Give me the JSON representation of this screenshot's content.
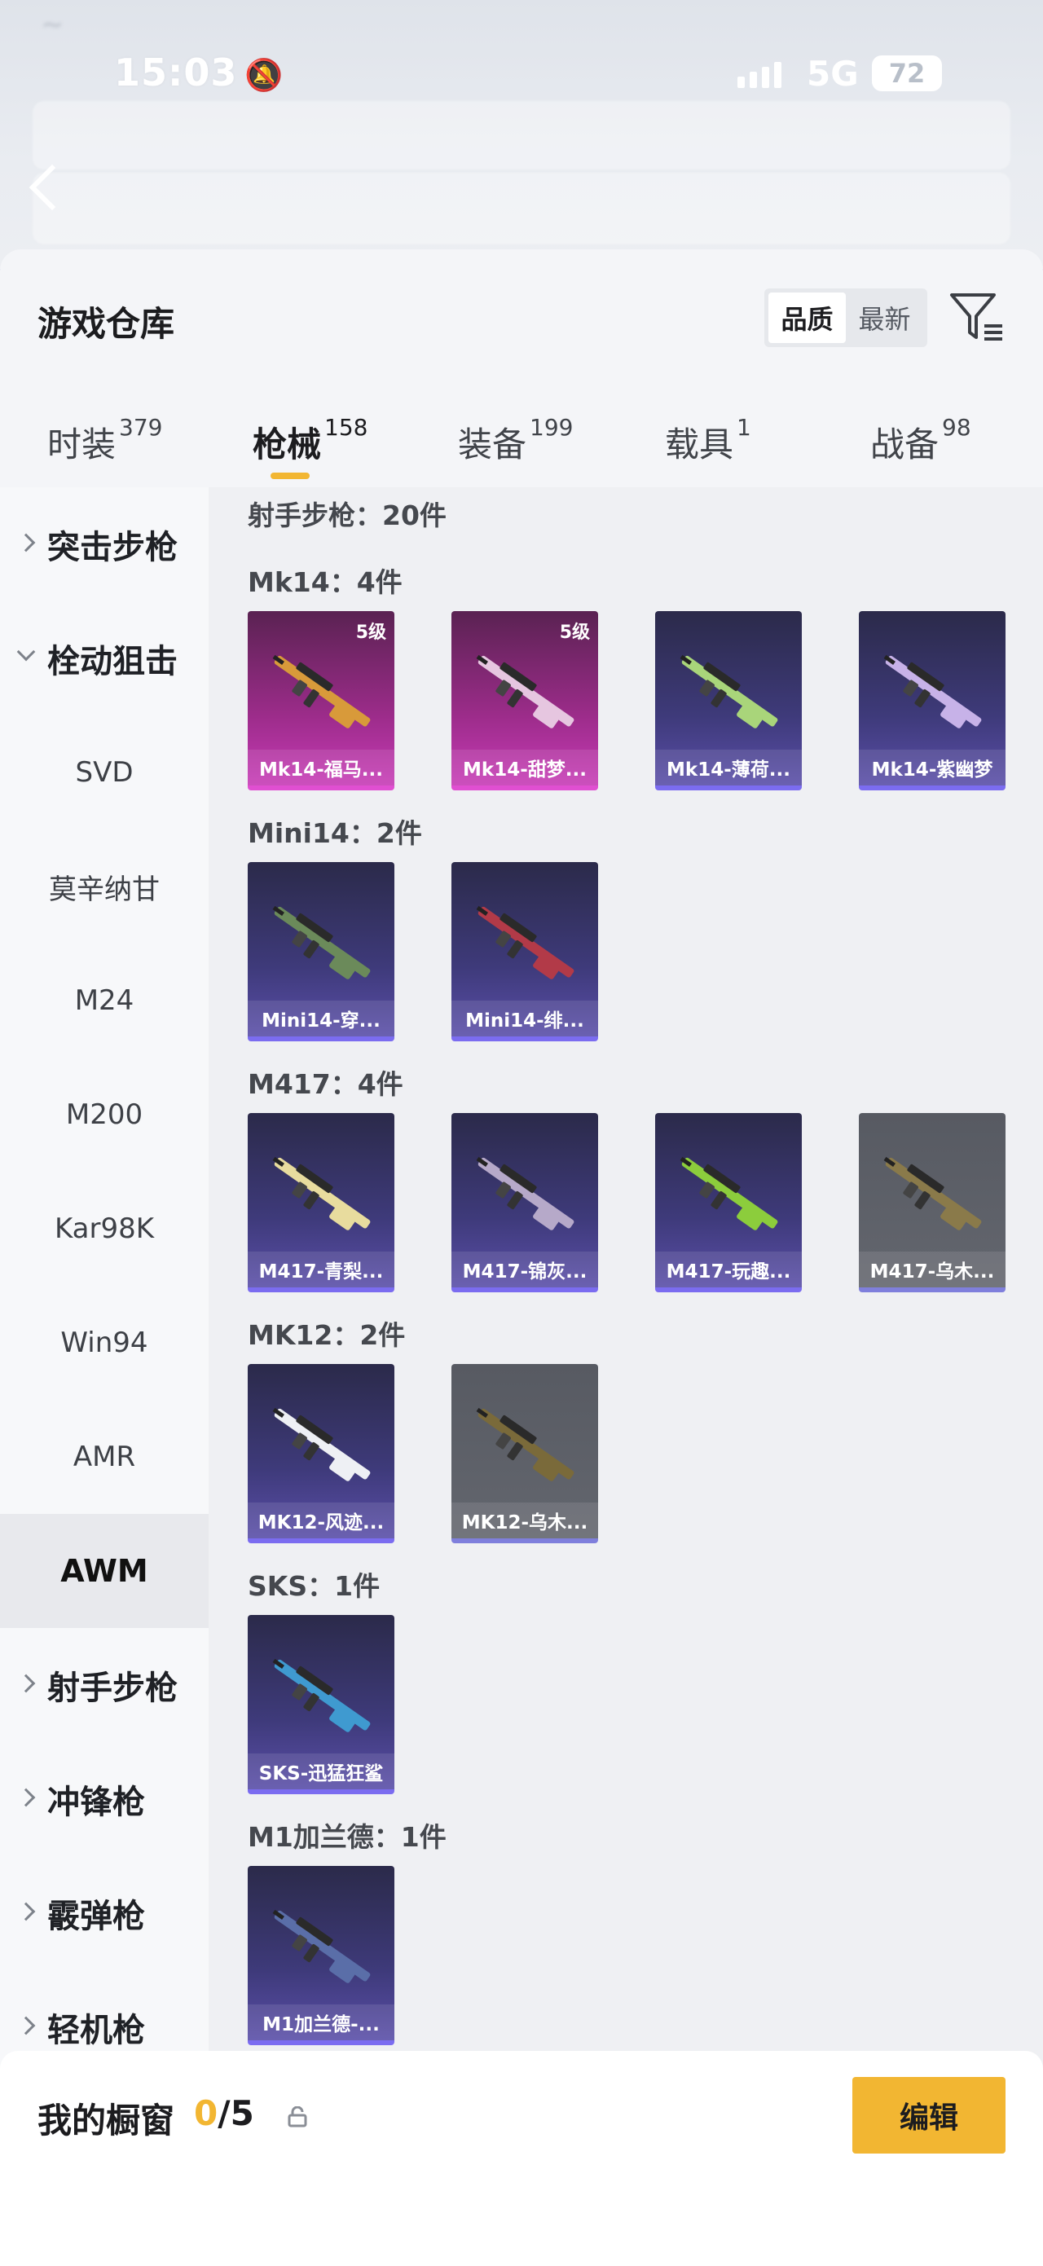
{
  "status_bar": {
    "time": "15:03",
    "network": "5G",
    "battery": "72"
  },
  "header": {
    "title": "游戏仓库",
    "sort_options": [
      "品质",
      "最新"
    ]
  },
  "tabs": [
    {
      "label": "时装",
      "count": "379"
    },
    {
      "label": "枪械",
      "count": "158"
    },
    {
      "label": "装备",
      "count": "199"
    },
    {
      "label": "载具",
      "count": "1"
    },
    {
      "label": "战备",
      "count": "98"
    }
  ],
  "sidebar": {
    "items": [
      {
        "label": "突击步枪"
      },
      {
        "label": "栓动狙击"
      },
      {
        "label": "SVD"
      },
      {
        "label": "莫辛纳甘"
      },
      {
        "label": "M24"
      },
      {
        "label": "M200"
      },
      {
        "label": "Kar98K"
      },
      {
        "label": "Win94"
      },
      {
        "label": "AMR"
      },
      {
        "label": "AWM"
      },
      {
        "label": "射手步枪"
      },
      {
        "label": "冲锋枪"
      },
      {
        "label": "霰弹枪"
      },
      {
        "label": "轻机枪"
      }
    ]
  },
  "sections": [
    {
      "title": "射手步枪：20件",
      "items": []
    },
    {
      "title": "Mk14：4件",
      "items": [
        {
          "name": "Mk14-福马...",
          "level": "5级",
          "rarity": "pink"
        },
        {
          "name": "Mk14-甜梦...",
          "level": "5级",
          "rarity": "pink"
        },
        {
          "name": "Mk14-薄荷...",
          "level": "",
          "rarity": "purple"
        },
        {
          "name": "Mk14-紫幽梦",
          "level": "",
          "rarity": "purple"
        }
      ]
    },
    {
      "title": "Mini14：2件",
      "items": [
        {
          "name": "Mini14-穿...",
          "level": "",
          "rarity": "purple"
        },
        {
          "name": "Mini14-绯...",
          "level": "",
          "rarity": "purple"
        }
      ]
    },
    {
      "title": "M417：4件",
      "items": [
        {
          "name": "M417-青梨...",
          "level": "",
          "rarity": "purple"
        },
        {
          "name": "M417-锦灰...",
          "level": "",
          "rarity": "purple"
        },
        {
          "name": "M417-玩趣...",
          "level": "",
          "rarity": "purple"
        },
        {
          "name": "M417-乌木...",
          "level": "",
          "rarity": "grey"
        }
      ]
    },
    {
      "title": "MK12：2件",
      "items": [
        {
          "name": "MK12-风迹...",
          "level": "",
          "rarity": "purple"
        },
        {
          "name": "MK12-乌木...",
          "level": "",
          "rarity": "grey"
        }
      ]
    },
    {
      "title": "SKS：1件",
      "items": [
        {
          "name": "SKS-迅猛狂鲨",
          "level": "",
          "rarity": "purple"
        }
      ]
    },
    {
      "title": "M1加兰德：1件",
      "items": [
        {
          "name": "M1加兰德-...",
          "level": "",
          "rarity": "purple"
        }
      ]
    }
  ],
  "showcase": {
    "label": "我的橱窗",
    "current": "0",
    "total": "/5",
    "edit_label": "编辑"
  },
  "colors": {
    "accent": "#f2b632",
    "pink_rarity": "#c73bb6",
    "purple_rarity": "#5a4ea8",
    "grey_rarity": "#63666e"
  },
  "icons": [
    "bell-muted-icon",
    "signal-icon",
    "back-arrow-icon",
    "filter-icon",
    "chevron-right-icon",
    "chevron-down-icon",
    "share-external-icon",
    "lock-icon"
  ]
}
